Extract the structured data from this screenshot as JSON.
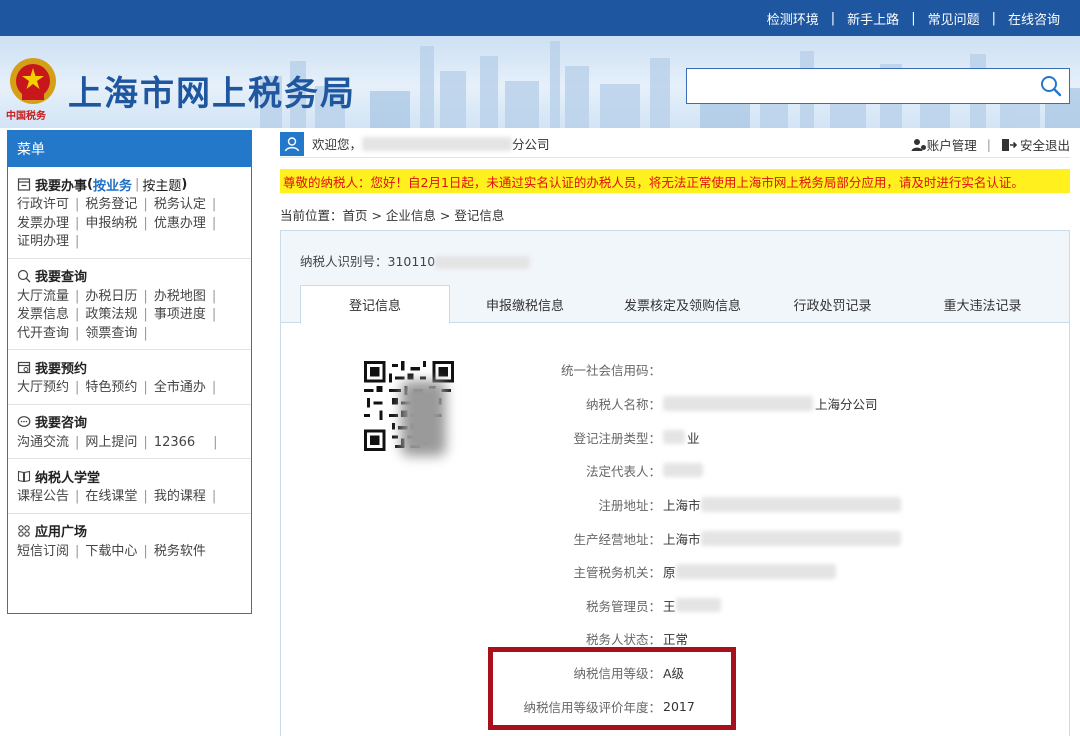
{
  "top_links": [
    "检测环境",
    "新手上路",
    "常见问题",
    "在线咨询"
  ],
  "brand": {
    "title": "上海市网上税务局",
    "sub": "中国税务"
  },
  "search": {
    "placeholder": ""
  },
  "sidebar": {
    "header": "菜单",
    "sections": [
      {
        "icon": "task-icon",
        "title": "我要办事",
        "title_paren_open": "(",
        "option_active": "按业务",
        "option_sep": "|",
        "option_other": "按主题",
        "title_paren_close": ")",
        "lines": [
          [
            "行政许可",
            "税务登记",
            "税务认定"
          ],
          [
            "发票办理",
            "申报纳税",
            "优惠办理"
          ],
          [
            "证明办理"
          ]
        ]
      },
      {
        "icon": "search-icon",
        "title": "我要查询",
        "lines": [
          [
            "大厅流量",
            "办税日历",
            "办税地图"
          ],
          [
            "发票信息",
            "政策法规",
            "事项进度"
          ],
          [
            "代开查询",
            "领票查询"
          ]
        ]
      },
      {
        "icon": "calendar-icon",
        "title": "我要预约",
        "lines": [
          [
            "大厅预约",
            "特色预约",
            "全市通办"
          ]
        ]
      },
      {
        "icon": "chat-icon",
        "title": "我要咨询",
        "lines": [
          [
            "沟通交流",
            "网上提问",
            "12366"
          ]
        ]
      },
      {
        "icon": "book-icon",
        "title": "纳税人学堂",
        "lines": [
          [
            "课程公告",
            "在线课堂",
            "我的课程"
          ]
        ]
      },
      {
        "icon": "grid-icon",
        "title": "应用广场",
        "lines": [
          [
            "短信订阅",
            "下载中心",
            "税务软件"
          ]
        ]
      }
    ]
  },
  "welcome": {
    "prefix": "欢迎您，",
    "company_suffix": "分公司",
    "account": "账户管理",
    "logout": "安全退出"
  },
  "notice": "尊敬的纳税人：您好！自2月1日起，未通过实名认证的办税人员，将无法正常使用上海市网上税务局部分应用，请及时进行实名认证。",
  "breadcrumb": "当前位置：首页 > 企业信息 > 登记信息",
  "taxpayer_id": {
    "label": "纳税人识别号：",
    "value_visible": "310110"
  },
  "tabs": [
    "登记信息",
    "申报缴税信息",
    "发票核定及领购信息",
    "行政处罚记录",
    "重大违法记录"
  ],
  "info": [
    {
      "label": "统一社会信用码：",
      "value": ""
    },
    {
      "label": "纳税人名称：",
      "value": "上海分公司"
    },
    {
      "label": "登记注册类型：",
      "value": "业"
    },
    {
      "label": "法定代表人：",
      "value": ""
    },
    {
      "label": "注册地址：",
      "value": "上海市"
    },
    {
      "label": "生产经营地址：",
      "value": "上海市"
    },
    {
      "label": "主管税务机关：",
      "value": "原"
    },
    {
      "label": "税务管理员：",
      "value": "王"
    },
    {
      "label": "税务人状态：",
      "value": "正常"
    },
    {
      "label": "纳税信用等级：",
      "value": "A级"
    },
    {
      "label": "纳税信用等级评价年度：",
      "value": "2017"
    }
  ],
  "colors": {
    "top_bar": "#1e56a0",
    "accent": "#2478c9",
    "notice_bg": "#fff01e",
    "notice_text": "#e01010",
    "highlight_box": "#a8101b"
  }
}
